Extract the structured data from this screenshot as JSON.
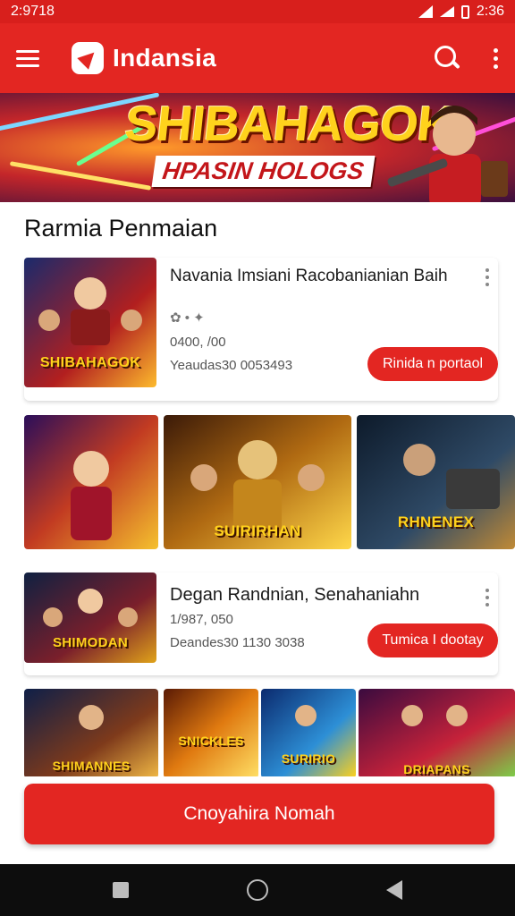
{
  "status_bar": {
    "time": "2:9718",
    "right_time": "2:36"
  },
  "app_bar": {
    "title": "Indansia"
  },
  "banner": {
    "title": "SHIBAHAGOK",
    "subtitle": "HPASIN HOLOGS"
  },
  "section": {
    "title": "Rarmia Penmaian"
  },
  "cards": [
    {
      "title": "Navania Imsiani Racobanianian Baih",
      "rating": "0400, /00",
      "meta": "Yeaudas30 0053493",
      "button": "Rinida n portaol",
      "thumb_label": "SHIBAHAGOK",
      "thumb_colors": [
        "#1a2a6c",
        "#b21f1f",
        "#fdbb2d"
      ]
    },
    {
      "title": "Degan Randnian, Senahaniahn",
      "rating": "1/987, 050",
      "meta": "Deandes30 1130 3038",
      "button": "Tumica I dootay",
      "thumb_label": "SHIMODAN",
      "thumb_colors": [
        "#0f2041",
        "#7a1f2b",
        "#e0a31a"
      ]
    }
  ],
  "grid_row_1": [
    {
      "label": "",
      "colors": [
        "#2b0e5a",
        "#c23b22",
        "#f5c12e"
      ]
    },
    {
      "label": "SUIRIRHAN",
      "colors": [
        "#3b1a08",
        "#b06a12",
        "#ffd84a"
      ]
    },
    {
      "label": "RHNENEX",
      "colors": [
        "#0d1a2a",
        "#2f4a66",
        "#c08a36"
      ]
    }
  ],
  "grid_row_2": [
    {
      "label": "SHIMANNES",
      "colors": [
        "#0e1f48",
        "#7e3a1b",
        "#f0b845"
      ]
    },
    {
      "label": "SNICKLES",
      "colors": [
        "#5a1a05",
        "#e07a10",
        "#ffe066"
      ]
    },
    {
      "label": "SURIRIO",
      "colors": [
        "#0b2a6e",
        "#2d8fd6",
        "#ffd21c"
      ]
    },
    {
      "label": "DRIAPANS",
      "colors": [
        "#3a0b3f",
        "#c6223a",
        "#7bd14a"
      ]
    }
  ],
  "cta": {
    "label": "Cnoyahira Nomah"
  },
  "colors": {
    "primary": "#e32622",
    "status": "#d81f1c",
    "nav": "#0d0d0d"
  }
}
